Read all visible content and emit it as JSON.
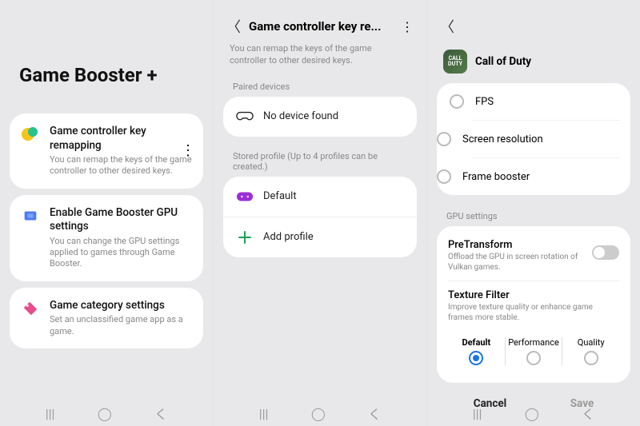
{
  "panel1": {
    "title": "Game Booster +",
    "cards": [
      {
        "title": "Game controller key remapping",
        "desc": "You can remap the keys of the game controller to other desired keys."
      },
      {
        "title": "Enable Game Booster GPU settings",
        "desc": "You can change the GPU settings applied to games through Game Booster."
      },
      {
        "title": "Game category settings",
        "desc": "Set an unclassified game app as a game."
      }
    ]
  },
  "panel2": {
    "header": "Game controller key re...",
    "desc": "You can remap the keys of the game controller to other desired keys.",
    "paired_label": "Paired devices",
    "no_device": "No device found",
    "stored_label": "Stored profile (Up to 4 profiles can be created.)",
    "default_profile": "Default",
    "add_profile": "Add profile"
  },
  "panel3": {
    "game": "Call of Duty",
    "options": [
      "FPS",
      "Screen resolution",
      "Frame booster"
    ],
    "gpu_label": "GPU settings",
    "pretransform": {
      "title": "PreTransform",
      "desc": "Offload the GPU in screen rotation of Vulkan games."
    },
    "texture": {
      "title": "Texture Filter",
      "desc": "Improve texture quality or enhance game frames more stable."
    },
    "tf_opts": [
      "Default",
      "Performance",
      "Quality"
    ],
    "cancel": "Cancel",
    "save": "Save"
  }
}
